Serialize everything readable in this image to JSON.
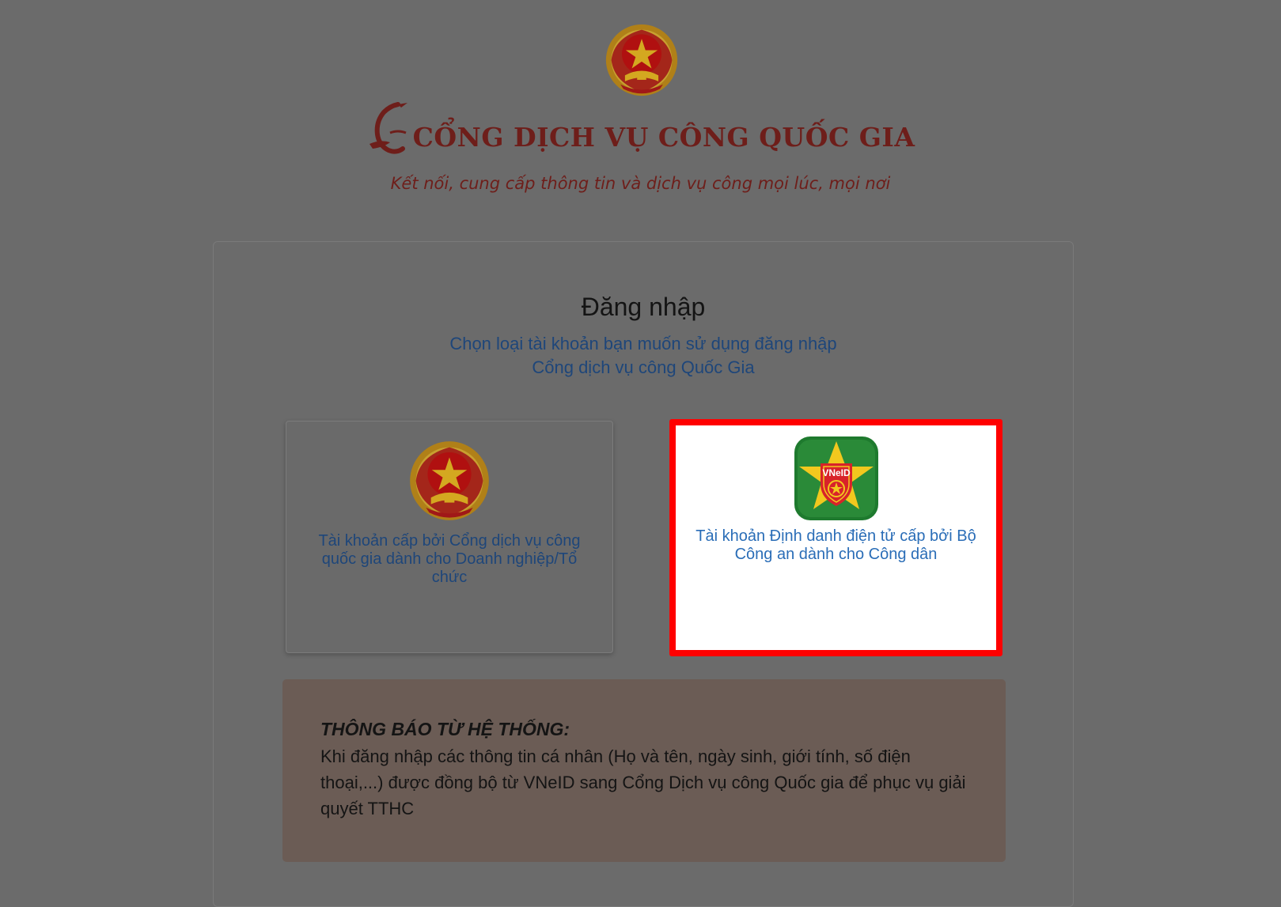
{
  "header": {
    "title": "CỔNG DỊCH VỤ CÔNG QUỐC GIA",
    "subtitle": "Kết nối, cung cấp thông tin và dịch vụ công mọi lúc, mọi nơi",
    "emblem_icon": "national-emblem-icon",
    "brand_icon": "crane-logo-icon"
  },
  "login": {
    "title": "Đăng nhập",
    "subtitle_line1": "Chọn loại tài khoản bạn muốn sử dụng đăng nhập",
    "subtitle_line2": "Cổng dịch vụ công Quốc Gia"
  },
  "options": [
    {
      "label": "Tài khoản cấp bởi Cổng dịch vụ công quốc gia dành cho Doanh nghiệp/Tổ chức",
      "icon": "national-emblem-icon",
      "highlighted": false
    },
    {
      "label": "Tài khoản Định danh điện tử cấp bởi Bộ Công an dành cho Công dân",
      "icon": "vneid-icon",
      "icon_text": "VNeID",
      "highlighted": true
    }
  ],
  "notice": {
    "title": "THÔNG BÁO TỪ HỆ THỐNG:",
    "body": "Khi đăng nhập các thông tin cá nhân (Họ và tên, ngày sinh, giới tính, số điện thoại,...) được đồng bộ từ VNeID sang Cổng Dịch vụ công Quốc gia để phục vụ giải quyết TTHC"
  },
  "colors": {
    "overlay": "#6b6b6b",
    "brand": "#6e1e1a",
    "link": "#2a6db7",
    "highlight_border": "#ff0000",
    "notice_bg": "#6b5c55"
  }
}
